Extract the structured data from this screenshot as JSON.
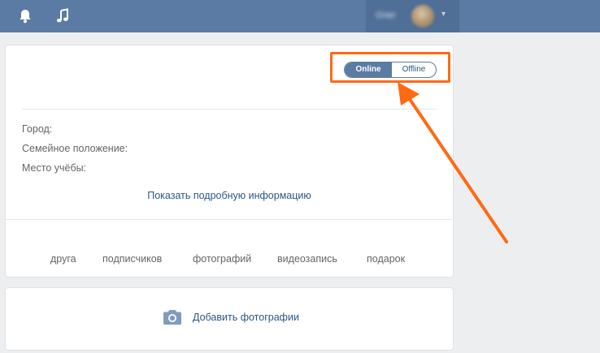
{
  "header": {
    "icons": [
      "bell-icon",
      "music-note-icon"
    ],
    "profile_name": "Олег",
    "bar_color": "#5b7ba4"
  },
  "status_toggle": {
    "online_label": "Online",
    "offline_label": "Offline",
    "selected": "Online"
  },
  "profile_fields": [
    {
      "label": "Город:"
    },
    {
      "label": "Семейное положение:"
    },
    {
      "label": "Место учёбы:"
    }
  ],
  "show_more_label": "Показать подробную информацию",
  "counters": [
    {
      "label": "друга"
    },
    {
      "label": "подписчиков"
    },
    {
      "label": "фотографий"
    },
    {
      "label": "видеозапись"
    },
    {
      "label": "подарок"
    }
  ],
  "photos_card": {
    "add_photos_label": "Добавить фотографии",
    "icon": "camera-icon"
  },
  "annotation": {
    "color": "#ff6a13"
  }
}
